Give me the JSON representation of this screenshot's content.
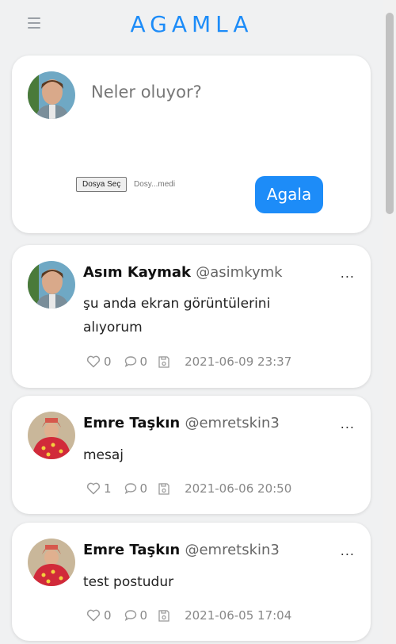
{
  "app": {
    "logo": "AGAMLA"
  },
  "composer": {
    "placeholder": "Neler oluyor?",
    "file_button": "Dosya Seç",
    "file_name": "Dosy...medi",
    "submit": "Agala"
  },
  "posts": [
    {
      "name": "Asım Kaymak",
      "handle": "@asimkymk",
      "text": "şu anda ekran görüntülerini alıyorum",
      "likes": "0",
      "comments": "0",
      "date": "2021-06-09 23:37"
    },
    {
      "name": "Emre Taşkın",
      "handle": "@emretskin3",
      "text": "mesaj",
      "likes": "1",
      "comments": "0",
      "date": "2021-06-06 20:50"
    },
    {
      "name": "Emre Taşkın",
      "handle": "@emretskin3",
      "text": "test postudur",
      "likes": "0",
      "comments": "0",
      "date": "2021-06-05 17:04"
    }
  ],
  "more_label": "...",
  "icons": {
    "menu": "hamburger-icon",
    "like": "heart-icon",
    "comment": "comment-icon",
    "save": "save-icon",
    "more": "more-icon"
  },
  "colors": {
    "accent": "#1d8cf8",
    "background": "#f0f1f2"
  }
}
